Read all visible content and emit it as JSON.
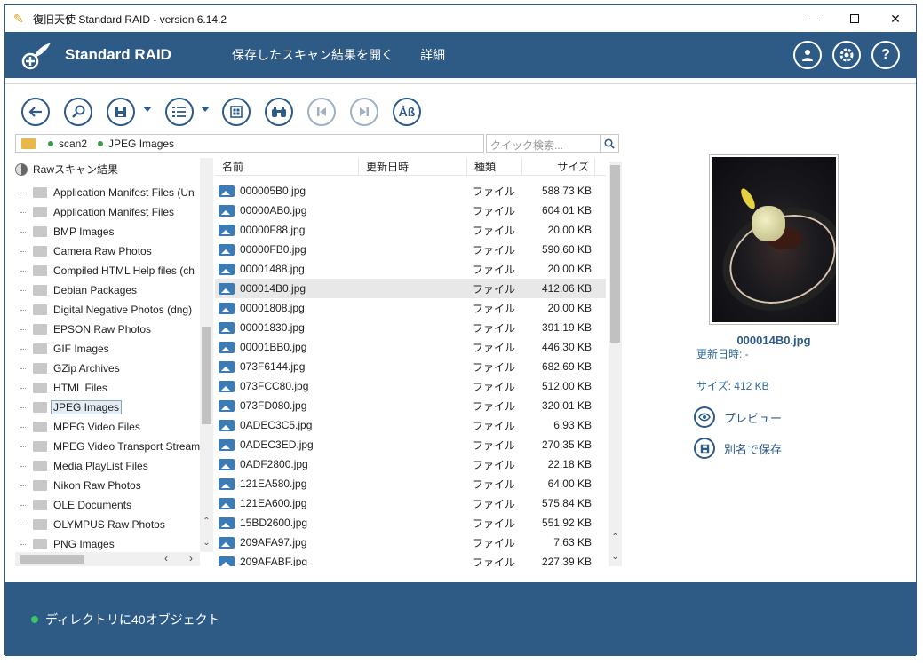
{
  "window": {
    "title": "復旧天使 Standard RAID - version 6.14.2",
    "minimize": "—",
    "close": "✕"
  },
  "header": {
    "brand": "Standard RAID",
    "menu": [
      "保存したスキャン結果を開く",
      "詳細"
    ],
    "user_icon": "user-icon",
    "settings_icon": "gear-icon",
    "help_label": "?"
  },
  "toolbar": {
    "buttons": [
      "back-icon",
      "search-scan-icon",
      "save-icon",
      "list-view-icon",
      "grid-view-icon",
      "binoculars-icon",
      "prev-icon",
      "next-icon",
      "ab-icon"
    ],
    "ab_label": "Åß"
  },
  "path": {
    "segments": [
      "scan2",
      "JPEG Images"
    ]
  },
  "search": {
    "placeholder": "クイック検索..."
  },
  "tree": {
    "root": "Rawスキャン結果",
    "items": [
      "Application Manifest Files (Un",
      "Application Manifest Files",
      "BMP Images",
      "Camera Raw Photos",
      "Compiled HTML Help files (ch",
      "Debian Packages",
      "Digital Negative Photos (dng)",
      "EPSON Raw Photos",
      "GIF Images",
      "GZip Archives",
      "HTML Files",
      "JPEG Images",
      "MPEG Video Files",
      "MPEG Video Transport Stream",
      "Media PlayList Files",
      "Nikon Raw Photos",
      "OLE Documents",
      "OLYMPUS Raw Photos",
      "PNG Images"
    ],
    "selected_index": 11
  },
  "filelist": {
    "columns": {
      "name": "名前",
      "date": "更新日時",
      "type": "種類",
      "size": "サイズ"
    },
    "rows": [
      {
        "name": "000005B0.jpg",
        "date": "",
        "type": "ファイル",
        "size": "588.73 KB"
      },
      {
        "name": "00000AB0.jpg",
        "date": "",
        "type": "ファイル",
        "size": "604.01 KB"
      },
      {
        "name": "00000F88.jpg",
        "date": "",
        "type": "ファイル",
        "size": "20.00 KB"
      },
      {
        "name": "00000FB0.jpg",
        "date": "",
        "type": "ファイル",
        "size": "590.60 KB"
      },
      {
        "name": "00001488.jpg",
        "date": "",
        "type": "ファイル",
        "size": "20.00 KB"
      },
      {
        "name": "000014B0.jpg",
        "date": "",
        "type": "ファイル",
        "size": "412.06 KB"
      },
      {
        "name": "00001808.jpg",
        "date": "",
        "type": "ファイル",
        "size": "20.00 KB"
      },
      {
        "name": "00001830.jpg",
        "date": "",
        "type": "ファイル",
        "size": "391.19 KB"
      },
      {
        "name": "00001BB0.jpg",
        "date": "",
        "type": "ファイル",
        "size": "446.30 KB"
      },
      {
        "name": "073F6144.jpg",
        "date": "",
        "type": "ファイル",
        "size": "682.69 KB"
      },
      {
        "name": "073FCC80.jpg",
        "date": "",
        "type": "ファイル",
        "size": "512.00 KB"
      },
      {
        "name": "073FD080.jpg",
        "date": "",
        "type": "ファイル",
        "size": "320.01 KB"
      },
      {
        "name": "0ADEC3C5.jpg",
        "date": "",
        "type": "ファイル",
        "size": "6.93 KB"
      },
      {
        "name": "0ADEC3ED.jpg",
        "date": "",
        "type": "ファイル",
        "size": "270.35 KB"
      },
      {
        "name": "0ADF2800.jpg",
        "date": "",
        "type": "ファイル",
        "size": "22.18 KB"
      },
      {
        "name": "121EA580.jpg",
        "date": "",
        "type": "ファイル",
        "size": "64.00 KB"
      },
      {
        "name": "121EA600.jpg",
        "date": "",
        "type": "ファイル",
        "size": "575.84 KB"
      },
      {
        "name": "15BD2600.jpg",
        "date": "",
        "type": "ファイル",
        "size": "551.92 KB"
      },
      {
        "name": "209AFA97.jpg",
        "date": "",
        "type": "ファイル",
        "size": "7.63 KB"
      },
      {
        "name": "209AFABF.jpg",
        "date": "",
        "type": "ファイル",
        "size": "227.39 KB"
      }
    ],
    "selected_index": 5
  },
  "preview": {
    "filename": "000014B0.jpg",
    "modified": "更新日時: -",
    "size": "サイズ: 412 KB",
    "preview_label": "プレビュー",
    "save_as_label": "別名で保存"
  },
  "status": {
    "text": "ディレクトリに40オブジェクト"
  },
  "colors": {
    "accent": "#2e5a86",
    "status_dot": "#3cc26a"
  }
}
